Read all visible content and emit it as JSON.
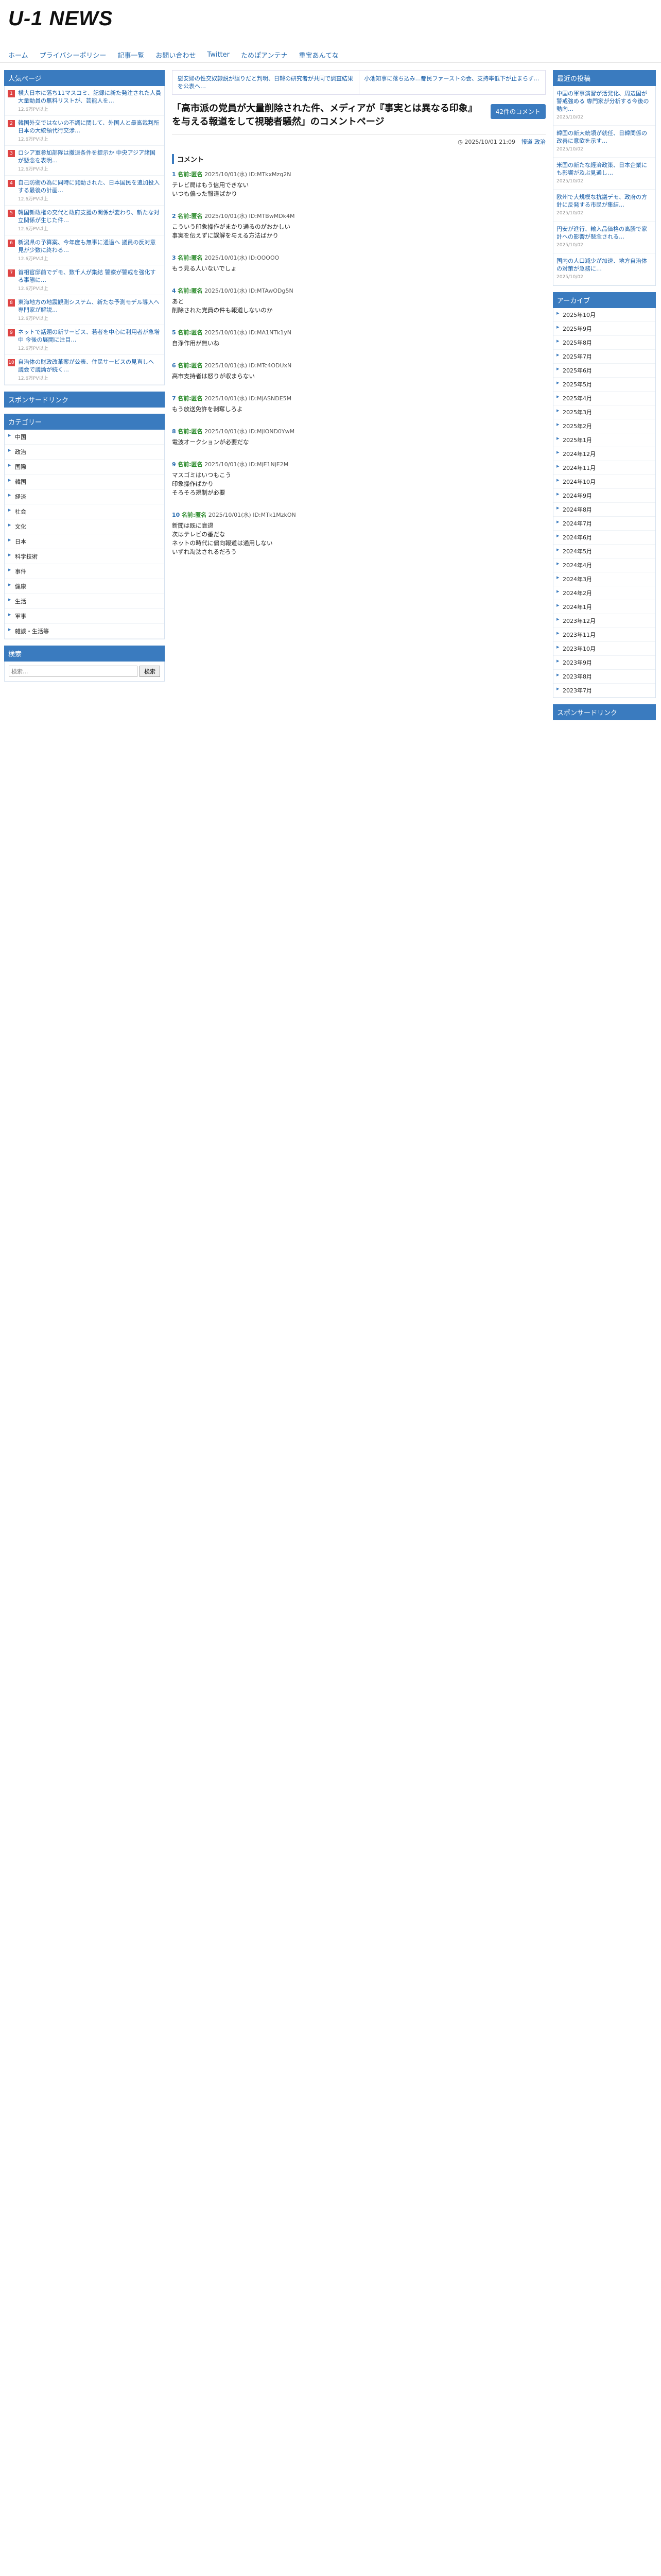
{
  "site": {
    "logo": "U-1 NEWS"
  },
  "nav": [
    {
      "label": "ホーム"
    },
    {
      "label": "プライバシーポリシー"
    },
    {
      "label": "記事一覧"
    },
    {
      "label": "お問い合わせ"
    },
    {
      "label": "Twitter"
    },
    {
      "label": "ためぽアンテナ"
    },
    {
      "label": "重宝あんてな"
    }
  ],
  "left": {
    "ranking_title": "人気ページ",
    "ranking": [
      {
        "num": "1",
        "title": "横大日本に落ち11マスコミ、記録に新た発注された人員大量動員の無料リストが、芸能人を…",
        "meta": "12.6万PV以上"
      },
      {
        "num": "2",
        "title": "韓国外交ではないの不調に関して、外国人と最高裁判所日本の大統領代行交渉…",
        "meta": "12.6万PV以上"
      },
      {
        "num": "3",
        "title": "ロシア軍参加部隊は撤退条件を提示か 中央アジア諸国が懸念を表明…",
        "meta": "12.6万PV以上"
      },
      {
        "num": "4",
        "title": "自己防衛の為に同時に発動された、日本国民を追加投入する最後の計画…",
        "meta": "12.6万PV以上"
      },
      {
        "num": "5",
        "title": "韓国新政権の交代と政府支援の関係が変わり、新たな対立関係が生じた件…",
        "meta": "12.6万PV以上"
      },
      {
        "num": "6",
        "title": "新潟県の予算案、今年度も無事に通過へ 議員の反対意見が少数に終わる…",
        "meta": "12.6万PV以上"
      },
      {
        "num": "7",
        "title": "首相官邸前でデモ、数千人が集結 警察が警戒を強化する事態に…",
        "meta": "12.6万PV以上"
      },
      {
        "num": "8",
        "title": "東海地方の地震観測システム、新たな予測モデル導入へ 専門家が解説…",
        "meta": "12.6万PV以上"
      },
      {
        "num": "9",
        "title": "ネットで話題の新サービス、若者を中心に利用者が急増中 今後の展開に注目…",
        "meta": "12.6万PV以上"
      },
      {
        "num": "10",
        "title": "自治体の財政改革案が公表、住民サービスの見直しへ 議会で議論が続く…",
        "meta": "12.6万PV以上"
      }
    ],
    "sponsor_title": "スポンサードリンク",
    "category_title": "カテゴリー",
    "categories": [
      {
        "label": "中国"
      },
      {
        "label": "政治"
      },
      {
        "label": "国際"
      },
      {
        "label": "韓国"
      },
      {
        "label": "経済"
      },
      {
        "label": "社会"
      },
      {
        "label": "文化"
      },
      {
        "label": "日本"
      },
      {
        "label": "科学技術"
      },
      {
        "label": "事件"
      },
      {
        "label": "健康"
      },
      {
        "label": "生活"
      },
      {
        "label": "軍事"
      },
      {
        "label": "雑談・生活等"
      }
    ],
    "search_title": "検索",
    "search_placeholder": "検索...",
    "search_button": "検索"
  },
  "main": {
    "prev": "慰安婦の性交奴隷説が誤りだと判明、日韓の研究者が共同で調査結果を公表へ…",
    "next": "小池知事に落ち込み…都民ファーストの会、支持率低下が止まらず…",
    "title": "「高市派の党員が大量削除された件、メディアが『事実とは異なる印象』を与える報道をして視聴者騒然」のコメントページ",
    "comment_count": "42件のコメント",
    "date": "2025/10/01 21:09",
    "category": "報道 政治",
    "comments_label": "コメント",
    "comments": [
      {
        "num": "1",
        "name": "名前:匿名",
        "date": "2025/10/01(水)",
        "id": "ID:MTkxMzg2N",
        "body": "テレビ局はもう信用できない\nいつも偏った報道ばかり"
      },
      {
        "num": "2",
        "name": "名前:匿名",
        "date": "2025/10/01(水)",
        "id": "ID:MTBwMDk4M",
        "body": "こういう印象操作がまかり通るのがおかしい\n事実を伝えずに誤解を与える方法ばかり"
      },
      {
        "num": "3",
        "name": "名前:匿名",
        "date": "2025/10/01(水)",
        "id": "ID:OOOOO",
        "body": "もう見る人いないでしょ"
      },
      {
        "num": "4",
        "name": "名前:匿名",
        "date": "2025/10/01(水)",
        "id": "ID:MTAwODg5N",
        "body": "あと\n削除された党員の件も報道しないのか"
      },
      {
        "num": "5",
        "name": "名前:匿名",
        "date": "2025/10/01(水)",
        "id": "ID:MA1NTk1yN",
        "body": "自浄作用が無いね"
      },
      {
        "num": "6",
        "name": "名前:匿名",
        "date": "2025/10/01(水)",
        "id": "ID:MTc4ODUxN",
        "body": "高市支持者は怒りが収まらない"
      },
      {
        "num": "7",
        "name": "名前:匿名",
        "date": "2025/10/01(水)",
        "id": "ID:MjASNDE5M",
        "body": "もう放送免許を剥奪しろよ"
      },
      {
        "num": "8",
        "name": "名前:匿名",
        "date": "2025/10/01(水)",
        "id": "ID:MjlOND0YwM",
        "body": "電波オークションが必要だな"
      },
      {
        "num": "9",
        "name": "名前:匿名",
        "date": "2025/10/01(水)",
        "id": "ID:MjE1NjE2M",
        "body": "マスゴミはいつもこう\n印象操作ばかり\nそろそろ規制が必要"
      },
      {
        "num": "10",
        "name": "名前:匿名",
        "date": "2025/10/01(水)",
        "id": "ID:MTk1MzkON",
        "body": "新聞は既に衰退\n次はテレビの番だな\nネットの時代に偏向報道は通用しない\nいずれ淘汰されるだろう"
      }
    ]
  },
  "right": {
    "recent_title": "最近の投稿",
    "recent": [
      {
        "title": "中国の軍事演習が活発化、周辺国が警戒強める 専門家が分析する今後の動向…",
        "meta": "2025/10/02"
      },
      {
        "title": "韓国の新大統領が就任、日韓関係の改善に意欲を示す…",
        "meta": "2025/10/02"
      },
      {
        "title": "米国の新たな経済政策、日本企業にも影響が及ぶ見通し…",
        "meta": "2025/10/02"
      },
      {
        "title": "欧州で大規模な抗議デモ、政府の方針に反発する市民が集結…",
        "meta": "2025/10/02"
      },
      {
        "title": "円安が進行、輸入品価格の高騰で家計への影響が懸念される…",
        "meta": "2025/10/02"
      },
      {
        "title": "国内の人口減少が加速、地方自治体の対策が急務に…",
        "meta": "2025/10/02"
      }
    ],
    "archive_title": "アーカイブ",
    "archives": [
      {
        "label": "2025年10月"
      },
      {
        "label": "2025年9月"
      },
      {
        "label": "2025年8月"
      },
      {
        "label": "2025年7月"
      },
      {
        "label": "2025年6月"
      },
      {
        "label": "2025年5月"
      },
      {
        "label": "2025年4月"
      },
      {
        "label": "2025年3月"
      },
      {
        "label": "2025年2月"
      },
      {
        "label": "2025年1月"
      },
      {
        "label": "2024年12月"
      },
      {
        "label": "2024年11月"
      },
      {
        "label": "2024年10月"
      },
      {
        "label": "2024年9月"
      },
      {
        "label": "2024年8月"
      },
      {
        "label": "2024年7月"
      },
      {
        "label": "2024年6月"
      },
      {
        "label": "2024年5月"
      },
      {
        "label": "2024年4月"
      },
      {
        "label": "2024年3月"
      },
      {
        "label": "2024年2月"
      },
      {
        "label": "2024年1月"
      },
      {
        "label": "2023年12月"
      },
      {
        "label": "2023年11月"
      },
      {
        "label": "2023年10月"
      },
      {
        "label": "2023年9月"
      },
      {
        "label": "2023年8月"
      },
      {
        "label": "2023年7月"
      }
    ],
    "sponsor_title": "スポンサードリンク"
  }
}
